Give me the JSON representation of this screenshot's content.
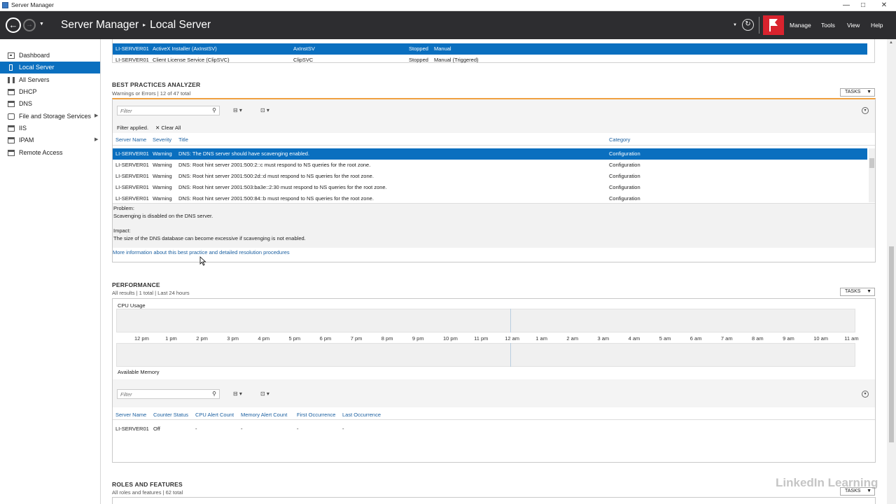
{
  "window": {
    "title": "Server Manager",
    "controls": [
      "—",
      "□",
      "✕"
    ]
  },
  "header": {
    "crumb_app": "Server Manager",
    "crumb_page": "Local Server",
    "menu": [
      "Manage",
      "Tools",
      "View",
      "Help"
    ]
  },
  "sidebar": {
    "items": [
      {
        "label": "Dashboard",
        "icon": "dashboard-icon"
      },
      {
        "label": "Local Server",
        "icon": "server-icon"
      },
      {
        "label": "All Servers",
        "icon": "servers-icon"
      },
      {
        "label": "DHCP",
        "icon": "dhcp-icon"
      },
      {
        "label": "DNS",
        "icon": "dns-icon"
      },
      {
        "label": "File and Storage Services",
        "icon": "storage-icon"
      },
      {
        "label": "IIS",
        "icon": "iis-icon"
      },
      {
        "label": "IPAM",
        "icon": "ipam-icon"
      },
      {
        "label": "Remote Access",
        "icon": "remote-access-icon"
      }
    ]
  },
  "services": {
    "rows": [
      {
        "server": "LI-SERVER01",
        "display": "ActiveX Installer (AxInstSV)",
        "name": "AxInstSV",
        "status": "Stopped",
        "start": "Manual"
      },
      {
        "server": "LI-SERVER01",
        "display": "Client License Service (ClipSVC)",
        "name": "ClipSVC",
        "status": "Stopped",
        "start": "Manual (Triggered)"
      }
    ]
  },
  "bpa": {
    "title": "BEST PRACTICES ANALYZER",
    "subtitle": "Warnings or Errors | 12 of 47 total",
    "tasks": "TASKS",
    "filter_placeholder": "Filter",
    "filter_applied": "Filter applied.",
    "clear_all": "Clear All",
    "columns": [
      "Server Name",
      "Severity",
      "Title",
      "Category"
    ],
    "rows": [
      {
        "server": "LI-SERVER01",
        "severity": "Warning",
        "title": "DNS: The DNS server should have scavenging enabled.",
        "category": "Configuration"
      },
      {
        "server": "LI-SERVER01",
        "severity": "Warning",
        "title": "DNS: Root hint server 2001:500:2::c must respond to NS queries for the root zone.",
        "category": "Configuration"
      },
      {
        "server": "LI-SERVER01",
        "severity": "Warning",
        "title": "DNS: Root hint server 2001:500:2d::d must respond to NS queries for the root zone.",
        "category": "Configuration"
      },
      {
        "server": "LI-SERVER01",
        "severity": "Warning",
        "title": "DNS: Root hint server 2001:503:ba3e::2:30 must respond to NS queries for the root zone.",
        "category": "Configuration"
      },
      {
        "server": "LI-SERVER01",
        "severity": "Warning",
        "title": "DNS: Root hint server 2001:500:84::b must respond to NS queries for the root zone.",
        "category": "Configuration"
      }
    ],
    "detail": {
      "problem_label": "Problem:",
      "problem": "Scavenging is disabled on the DNS server.",
      "impact_label": "Impact:",
      "impact": "The size of the DNS database can become excessive if scavenging is not enabled.",
      "more_link": "More information about this best practice and detailed resolution procedures"
    }
  },
  "performance": {
    "title": "PERFORMANCE",
    "subtitle": "All results | 1 total | Last 24 hours",
    "tasks": "TASKS",
    "cpu_label": "CPU Usage",
    "mem_label": "Available Memory",
    "hours": [
      "12 pm",
      "1 pm",
      "2 pm",
      "3 pm",
      "4 pm",
      "5 pm",
      "6 pm",
      "7 pm",
      "8 pm",
      "9 pm",
      "10 pm",
      "11 pm",
      "12 am",
      "1 am",
      "2 am",
      "3 am",
      "4 am",
      "5 am",
      "6 am",
      "7 am",
      "8 am",
      "9 am",
      "10 am",
      "11 am"
    ],
    "filter_placeholder": "Filter",
    "columns": [
      "Server Name",
      "Counter Status",
      "CPU Alert Count",
      "Memory Alert Count",
      "First Occurrence",
      "Last Occurrence"
    ],
    "rows": [
      {
        "server": "LI-SERVER01",
        "status": "Off",
        "cpu": "-",
        "mem": "-",
        "first": "-",
        "last": "-"
      }
    ]
  },
  "roles": {
    "title": "ROLES AND FEATURES",
    "subtitle": "All roles and features | 62 total",
    "tasks": "TASKS"
  },
  "watermark": "LinkedIn Learning"
}
